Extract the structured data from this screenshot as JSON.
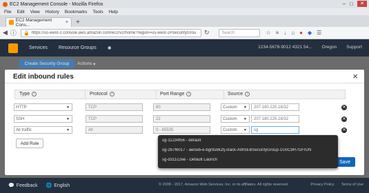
{
  "browser": {
    "window_title": "EC2 Management Console - Mozilla Firefox",
    "menu": [
      "File",
      "Edit",
      "View",
      "History",
      "Bookmarks",
      "Tools",
      "Help"
    ],
    "tab_label": "EC2 Management Cons...",
    "url": "https://us-west-2.console.aws.amazon.com/ec2/v2/home?region=us-west-2#SecurityGrou",
    "search_placeholder": "Search"
  },
  "aws_nav": {
    "services": "Services",
    "resource_groups": "Resource Groups",
    "account": "1234-5678-9012 4321 54...",
    "region": "Oregon",
    "support": "Support"
  },
  "page": {
    "create_button": "Create Security Group",
    "actions_button": "Actions"
  },
  "modal": {
    "title": "Edit inbound rules",
    "headers": {
      "type": "Type",
      "protocol": "Protocol",
      "port_range": "Port Range",
      "source": "Source"
    },
    "rules": [
      {
        "type": "HTTP",
        "protocol": "TCP",
        "port": "80",
        "source_type": "Custom",
        "source_value": "207.180.225.18/32"
      },
      {
        "type": "SSH",
        "protocol": "TCP",
        "port": "22",
        "source_type": "Custom",
        "source_value": "207.180.225.18/32"
      },
      {
        "type": "All traffic",
        "protocol": "All",
        "port": "0 - 65535",
        "source_type": "Custom",
        "source_value": "sg"
      }
    ],
    "add_rule": "Add Rule",
    "save": "Save"
  },
  "dropdown": {
    "items": [
      "sg-11234f56 - default",
      "sg-2b7f6017 - awseb-e-bgntu8k2tj-stack-AWSEBSecurityGroup-1G0C9R7GFIUN",
      "sg-d311c2ee - Default Launch"
    ]
  },
  "footer": {
    "feedback": "Feedback",
    "language": "English",
    "copyright": "© 2008 - 2017, Amazon Web Services, Inc. or its affiliates. All rights reserved.",
    "privacy": "Privacy Policy",
    "terms": "Terms of Use"
  }
}
